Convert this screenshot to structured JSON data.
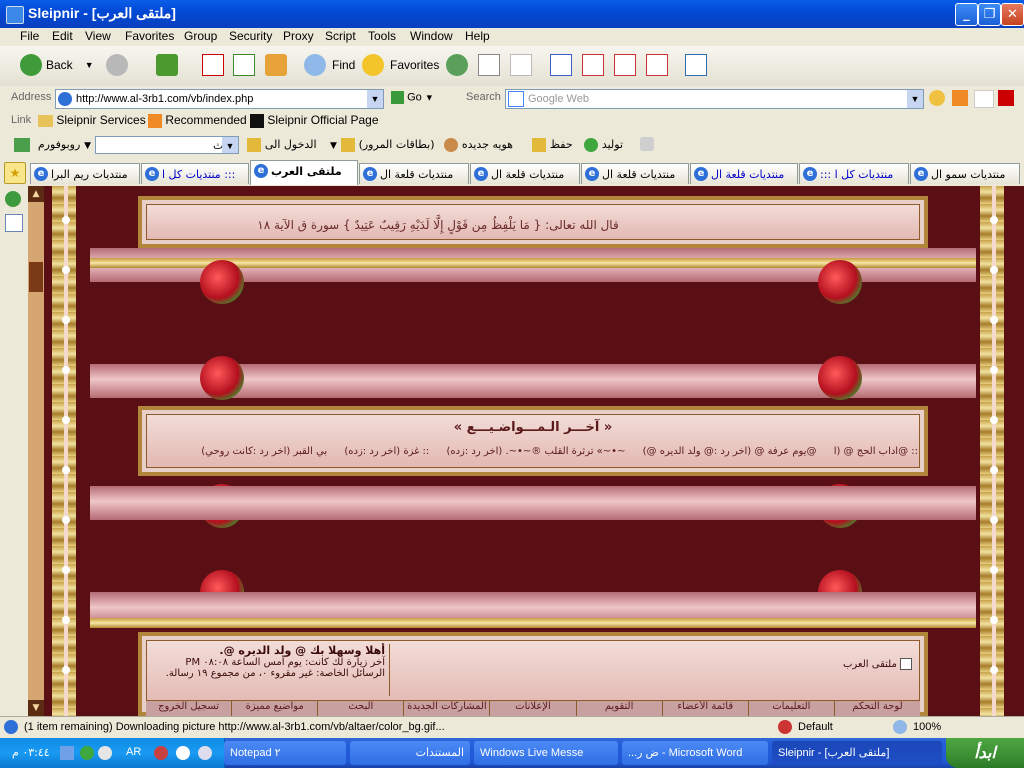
{
  "window": {
    "title": "Sleipnir - [ملتقى العرب]",
    "min": "_",
    "max": "❐",
    "close": "✕"
  },
  "menu": [
    "File",
    "Edit",
    "View",
    "Favorites",
    "Group",
    "Security",
    "Proxy",
    "Script",
    "Tools",
    "Window",
    "Help"
  ],
  "toolbar": {
    "back": "Back",
    "find": "Find",
    "favorites": "Favorites"
  },
  "address": {
    "label": "Address",
    "url": "http://www.al-3rb1.com/vb/index.php",
    "go": "Go",
    "search_label": "Search",
    "search_placeholder": "Google Web"
  },
  "links": {
    "label": "Link",
    "items": [
      "Sleipnir Services",
      "Recommended",
      "Sleipnir Official Page"
    ]
  },
  "searchbar": {
    "robot": "روبوفورم",
    "field": "بحث",
    "login": "الدخول الى",
    "cards": "(بطاقات المرور)",
    "newid": "هويه جديده",
    "save": "حفظ",
    "generate": "توليد"
  },
  "tabs": [
    {
      "label": "منتديات ريم البرا"
    },
    {
      "label": "منتديات كل ا :::"
    },
    {
      "label": "ملتقى العرب",
      "active": true
    },
    {
      "label": "منتديات قلعة ال"
    },
    {
      "label": "منتديات قلعة ال"
    },
    {
      "label": "منتديات قلعة ال"
    },
    {
      "label": "منتديات قلعة ال"
    },
    {
      "label": "::: منتديات كل ا"
    },
    {
      "label": "منتديات سمو ال"
    }
  ],
  "page": {
    "verse": "قال الله تعالى: { مَا يَلْفِظُ مِن قَوْلٍ إِلَّا لَدَيْهِ رَقِيبٌ عَتِيدٌ } سورة ق الآية ١٨",
    "latest_title": "« آخـــر الـمـــواضـيـــع »",
    "latest_items": [
      ":: @اداب الحج @ (آ",
      "@يوم عرفة @ (آخر رد :@ ولد الديره @)",
      "~•~» ترثرة القلب ®~•~. (آخر رد :زده)",
      ":: غزة (آخر رد :زده)",
      "بي القبر (آخر رد :كانت روحي)"
    ],
    "welcome": "أهلا وسهلا بك @ ولد الديره @.",
    "last_visit": "آخر زيارة لك كانت: يوم أمس الساعة ٠٨:٠٨ PM",
    "private_msgs": "الرسائل الخاصة: غير مقروء ٠، من مجموع ١٩ رسالة.",
    "forum_name": "ملتقى العرب",
    "nav": [
      "لوحة التحكم",
      "التعليمات",
      "قائمة الأعضاء",
      "التقويم",
      "الإعلانات",
      "المشاركات الجديدة",
      "البحث",
      "مواضيع مميزة",
      "تسجيل الخروج"
    ]
  },
  "status": {
    "text": "(1 item remaining) Downloading picture http://www.al-3rb1.com/vb/altaer/color_bg.gif...",
    "zone": "Default",
    "zoom": "100%"
  },
  "taskbar": {
    "clock": "٠٣:٤٤ م",
    "lang": "AR",
    "start": "ابدأ",
    "tasks": [
      "Notepad ٢",
      "المستندات",
      "Windows Live Messe",
      "...ض ر - Microsoft Word",
      "Sleipnir - [ملتقى العرب]"
    ]
  }
}
